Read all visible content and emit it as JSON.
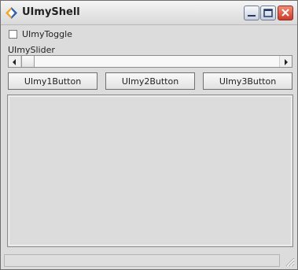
{
  "window": {
    "title": "UImyShell",
    "controls": [
      "minimize-icon",
      "maximize-icon",
      "close-icon"
    ]
  },
  "toggle": {
    "label": "UImyToggle",
    "checked": false
  },
  "slider": {
    "label": "UImySlider",
    "value": 0.07
  },
  "buttons": [
    {
      "label": "UImy1Button"
    },
    {
      "label": "UImy2Button"
    },
    {
      "label": "UImy3Button"
    }
  ]
}
